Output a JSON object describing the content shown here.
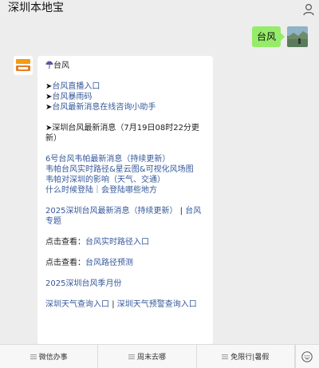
{
  "header": {
    "title": "深圳本地宝",
    "user_icon": "user-icon"
  },
  "outgoing": {
    "text": "台风",
    "bubble_color": "#95ec69"
  },
  "message": {
    "title": "台风",
    "items": [
      {
        "prefix": "➤",
        "text": "台风直播入口",
        "link": true
      },
      {
        "prefix": "➤",
        "text": "台风暴雨码",
        "link": true
      },
      {
        "prefix": "➤",
        "text": "台风最新消息在线咨询小助手",
        "link": true
      },
      {
        "prefix": "➤",
        "text": "深圳台风最新消息（7月19日08时22分更新）",
        "link": false
      }
    ],
    "group_links": [
      "6号台风韦帕最新消息（持续更新）",
      "韦帕台风实时路径&星云图&可视化风场图",
      "韦帕对深圳的影响（天气、交通）",
      "什么时候登陆｜会登陆哪些地方"
    ],
    "special": {
      "text": "2025深圳台风最新消息（持续更新）",
      "sep": "|",
      "text2": "台风专题"
    },
    "check1": {
      "label": "点击查看：",
      "link": "台风实时路径入口"
    },
    "check2": {
      "label": "点击查看：",
      "link": "台风路径预测"
    },
    "month": "2025深圳台风季月份",
    "weather": {
      "left": "深圳天气查询入口",
      "sep": "|",
      "right": "深圳天气预警查询入口"
    },
    "link_color": "#35589a"
  },
  "bottom": {
    "keyboard_icon": "keyboard-icon",
    "menus": [
      "微信办事",
      "周末去哪",
      "免限行|暑假"
    ]
  }
}
